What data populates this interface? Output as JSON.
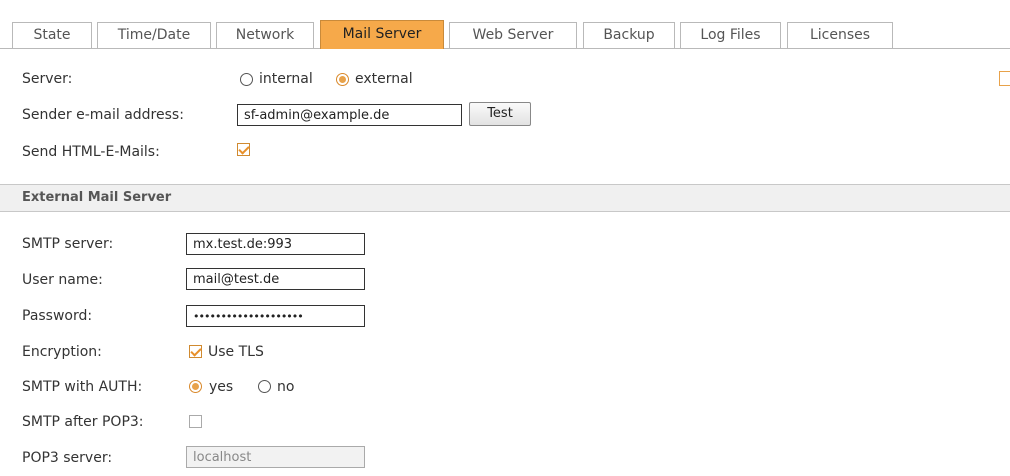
{
  "tabs": [
    {
      "label": "State"
    },
    {
      "label": "Time/Date"
    },
    {
      "label": "Network"
    },
    {
      "label": "Mail Server",
      "active": true
    },
    {
      "label": "Web Server"
    },
    {
      "label": "Backup"
    },
    {
      "label": "Log Files"
    },
    {
      "label": "Licenses"
    }
  ],
  "general": {
    "server_label": "Server:",
    "server_options": [
      {
        "label": "internal",
        "selected": false
      },
      {
        "label": "external",
        "selected": true
      }
    ],
    "sender_label": "Sender e-mail address:",
    "sender_value": "sf-admin@example.de",
    "test_button": "Test",
    "html_mails_label": "Send HTML-E-Mails:",
    "html_mails_checked": true
  },
  "section_title": "External Mail Server",
  "external": {
    "smtp_server_label": "SMTP server:",
    "smtp_server_value": "mx.test.de:993",
    "user_label": "User name:",
    "user_value": "mail@test.de",
    "password_label": "Password:",
    "password_value": "••••••••••••••••••••",
    "encryption_label": "Encryption:",
    "encryption_option": "Use TLS",
    "encryption_checked": true,
    "auth_label": "SMTP with AUTH:",
    "auth_options": [
      {
        "label": "yes",
        "selected": true
      },
      {
        "label": "no",
        "selected": false
      }
    ],
    "pop3_after_label": "SMTP after POP3:",
    "pop3_after_checked": false,
    "pop3_server_label": "POP3 server:",
    "pop3_server_value": "localhost"
  },
  "colors": {
    "accent": "#f6a94a",
    "radio_fill": "#e8a24a"
  }
}
